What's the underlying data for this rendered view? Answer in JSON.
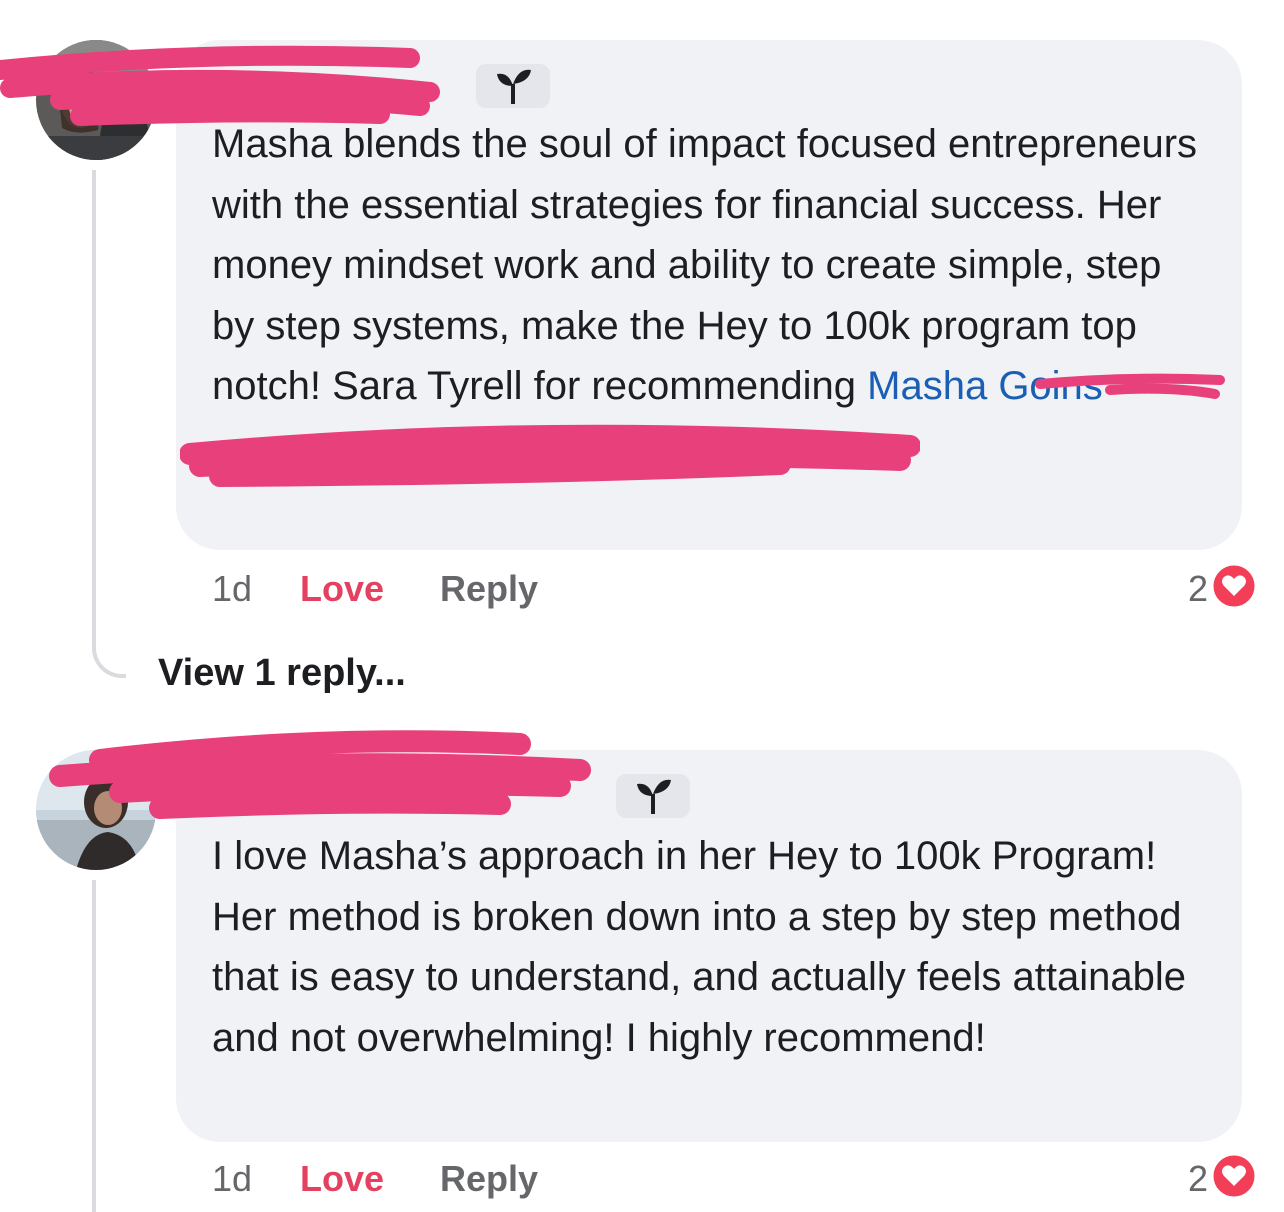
{
  "comments": [
    {
      "author": "",
      "text_before_mention": "Masha blends the soul of impact focused entrepreneurs with the essential strategies for financial success. Her money mindset work and ability to create simple, step by step systems, make the Hey to 100k program top notch! ",
      "redacted_fragment": "Sara Tyrell for recommending",
      "text_suffix": "ing ",
      "mention": "Masha Goins",
      "time": "1d",
      "love_label": "Love",
      "reply_label": "Reply",
      "reaction_count": "2",
      "reaction_icon": "heart-icon"
    },
    {
      "author": "",
      "text": "I love Masha’s approach in her Hey to 100k Program! Her method is broken down into a step by step method that is easy to understand, and actually feels attainable and not overwhelming! I highly recommend!",
      "time": "1d",
      "love_label": "Love",
      "reply_label": "Reply",
      "reaction_count": "2",
      "reaction_icon": "heart-icon"
    }
  ],
  "view_replies_label": "View 1 reply...",
  "colors": {
    "bubble": "#f0f2f5",
    "love": "#e4405f",
    "mention": "#1a5fb4",
    "redaction": "#e8407a",
    "meta": "#65676b"
  },
  "badge_icon": "sprout-icon"
}
